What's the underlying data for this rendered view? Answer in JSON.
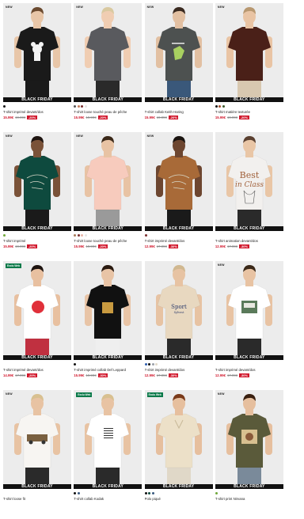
{
  "banner_label": "BLACK FRIDAY",
  "products": [
    {
      "badge": "NEW",
      "badge_type": "new",
      "title": "T-shirt imprimé devant/dos",
      "price": "15.99€",
      "old_price": "19.99€",
      "discount": "-20%",
      "swatches": [
        "#111111"
      ],
      "bg": "#ececec",
      "shirt": "#1a1a1a",
      "pants": "#1a1a1a",
      "skin": "#e8c6a8",
      "hair": "#6b4a2f",
      "print": "mickey"
    },
    {
      "badge": "NEW",
      "badge_type": "new",
      "title": "T-shirt loose touché peau de pêche",
      "price": "15.99€",
      "old_price": "19.99€",
      "discount": "-20%",
      "swatches": [
        "#555555",
        "#c47a5a",
        "#7a2f2f",
        "#e5e5e5"
      ],
      "bg": "#ececec",
      "shirt": "#595a5e",
      "pants": "#2a2a2a",
      "skin": "#f0cdb2",
      "hair": "#d9c9a0",
      "print": "none"
    },
    {
      "badge": "NEW",
      "badge_type": "new",
      "title": "T-shirt collab Keith Haring",
      "price": "15.99€",
      "old_price": "19.99€",
      "discount": "-20%",
      "swatches": [],
      "bg": "#ececec",
      "shirt": "#4d5150",
      "pants": "#3a587a",
      "skin": "#e2c0a2",
      "hair": "#3a2a20",
      "print": "frog"
    },
    {
      "badge": "NEW",
      "badge_type": "new",
      "title": "T-shirt matière texturée",
      "price": "15.99€",
      "old_price": "19.99€",
      "discount": "-20%",
      "swatches": [
        "#111111",
        "#a34d2a",
        "#3c5a2c"
      ],
      "bg": "#ececec",
      "shirt": "#4a2018",
      "pants": "#d8c8b0",
      "skin": "#e9c4a4",
      "hair": "#b89870",
      "print": "none"
    },
    {
      "badge": "NEW",
      "badge_type": "new",
      "title": "T-shirt imprimé",
      "price": "15.99€",
      "old_price": "19.99€",
      "discount": "-20%",
      "swatches": [
        "#6fa83a"
      ],
      "bg": "#ececec",
      "shirt": "#0e4a3e",
      "pants": "#1a1a1a",
      "skin": "#7a5238",
      "hair": "#1e1410",
      "print": "sketch"
    },
    {
      "badge": "NEW",
      "badge_type": "new",
      "title": "T-shirt loose touché peau de pêche",
      "price": "15.99€",
      "old_price": "19.99€",
      "discount": "-20%",
      "swatches": [
        "#a67a5a",
        "#7a2f2f",
        "#e8b5a8",
        "#e5e5e5"
      ],
      "bg": "#ececec",
      "shirt": "#f7cbbd",
      "pants": "#9a9a9a",
      "skin": "#e8c3a4",
      "hair": "#3a2818",
      "print": "none"
    },
    {
      "badge": "NEW",
      "badge_type": "new",
      "title": "T-shirt imprimé devant/dos",
      "price": "12.99€",
      "old_price": "17.99€",
      "discount": "-30%",
      "swatches": [
        "#7a2f2f"
      ],
      "bg": "#ececec",
      "shirt": "#a86a38",
      "pants": "#1a1a1a",
      "skin": "#6d4630",
      "hair": "#1a1410",
      "print": "sketch"
    },
    {
      "badge": "",
      "badge_type": "none",
      "title": "T-shirt animation devant/dos",
      "price": "12.99€",
      "old_price": "17.99€",
      "discount": "-30%",
      "swatches": [],
      "bg": "#ececec",
      "shirt": "#f2f0ee",
      "pants": "#2a2a2a",
      "skin": "#e9c6a6",
      "hair": "#5a4030",
      "print": "bestinclass",
      "print_line1": "Best",
      "print_line2": "in Class"
    },
    {
      "badge": "Exclu Web",
      "badge_type": "tag",
      "title": "T-shirt imprimé devant/dos",
      "price": "14.99€",
      "old_price": "17.99€",
      "discount": "-20%",
      "swatches": [],
      "bg": "#ececec",
      "shirt": "#ffffff",
      "pants": "#c03040",
      "skin": "#e8c0a0",
      "hair": "#1e1410",
      "print": "xmas"
    },
    {
      "badge": "",
      "badge_type": "none",
      "title": "T-shirt imprimé collab Def Leppard",
      "price": "15.99€",
      "old_price": "19.99€",
      "discount": "-30%",
      "swatches": [
        "#111111"
      ],
      "bg": "#ececec",
      "shirt": "#111111",
      "pants": "#efefef",
      "skin": "#e8c4a6",
      "hair": "#2a1a10",
      "print": "band"
    },
    {
      "badge": "",
      "badge_type": "none",
      "title": "T-shirt imprimé devant/dos",
      "price": "12.99€",
      "old_price": "17.99€",
      "discount": "-30%",
      "swatches": [
        "#3060b0",
        "#111111",
        "#9aa0a8",
        "#e0d8c8"
      ],
      "bg": "#ececec",
      "shirt": "#e8d8c0",
      "pants": "#2a2a2a",
      "skin": "#e7c3a3",
      "hair": "#d0b890",
      "print": "sport",
      "print_line1": "Sport",
      "print_line2": "Sylvest"
    },
    {
      "badge": "NEW",
      "badge_type": "new",
      "title": "T-shirt imprimé devant/dos",
      "price": "12.99€",
      "old_price": "17.99€",
      "discount": "-30%",
      "swatches": [],
      "bg": "#ececec",
      "shirt": "#ffffff",
      "pants": "#2a2a2a",
      "skin": "#e8c3a3",
      "hair": "#3a2818",
      "print": "photo"
    },
    {
      "badge": "NEW",
      "badge_type": "new",
      "title": "T-shirt loose fit",
      "price": "",
      "old_price": "",
      "discount": "",
      "swatches": [],
      "bg": "#ececec",
      "shirt": "#f7f5f2",
      "pants": "#2a2a2a",
      "skin": "#e8c3a3",
      "hair": "#d8c090",
      "print": "jeep"
    },
    {
      "badge": "Exclu Web",
      "badge_type": "tag",
      "title": "T-shirt collab Kodak",
      "price": "",
      "old_price": "",
      "discount": "",
      "swatches": [
        "#111111",
        "#3a5a80"
      ],
      "bg": "#ececec",
      "shirt": "#ffffff",
      "pants": "#2a2a2a",
      "skin": "#e8c3a3",
      "hair": "#d8c090",
      "print": "text"
    },
    {
      "badge": "Exclu Web",
      "badge_type": "tag",
      "title": "Polo piqué",
      "price": "",
      "old_price": "",
      "discount": "",
      "swatches": [
        "#111111",
        "#0e4a3e",
        "#3a5a80"
      ],
      "bg": "#ececec",
      "shirt": "#ece0c8",
      "pants": "#e0d8c8",
      "skin": "#e6bf9e",
      "hair": "#7a3a1a",
      "print": "polo"
    },
    {
      "badge": "NEW",
      "badge_type": "new",
      "title": "T-shirt print Nirvana",
      "price": "",
      "old_price": "",
      "discount": "",
      "swatches": [
        "#6fa83a"
      ],
      "bg": "#ececec",
      "shirt": "#5a5a3a",
      "pants": "#7a8a9a",
      "skin": "#e6bf9e",
      "hair": "#3a2010",
      "print": "nirvana"
    }
  ]
}
